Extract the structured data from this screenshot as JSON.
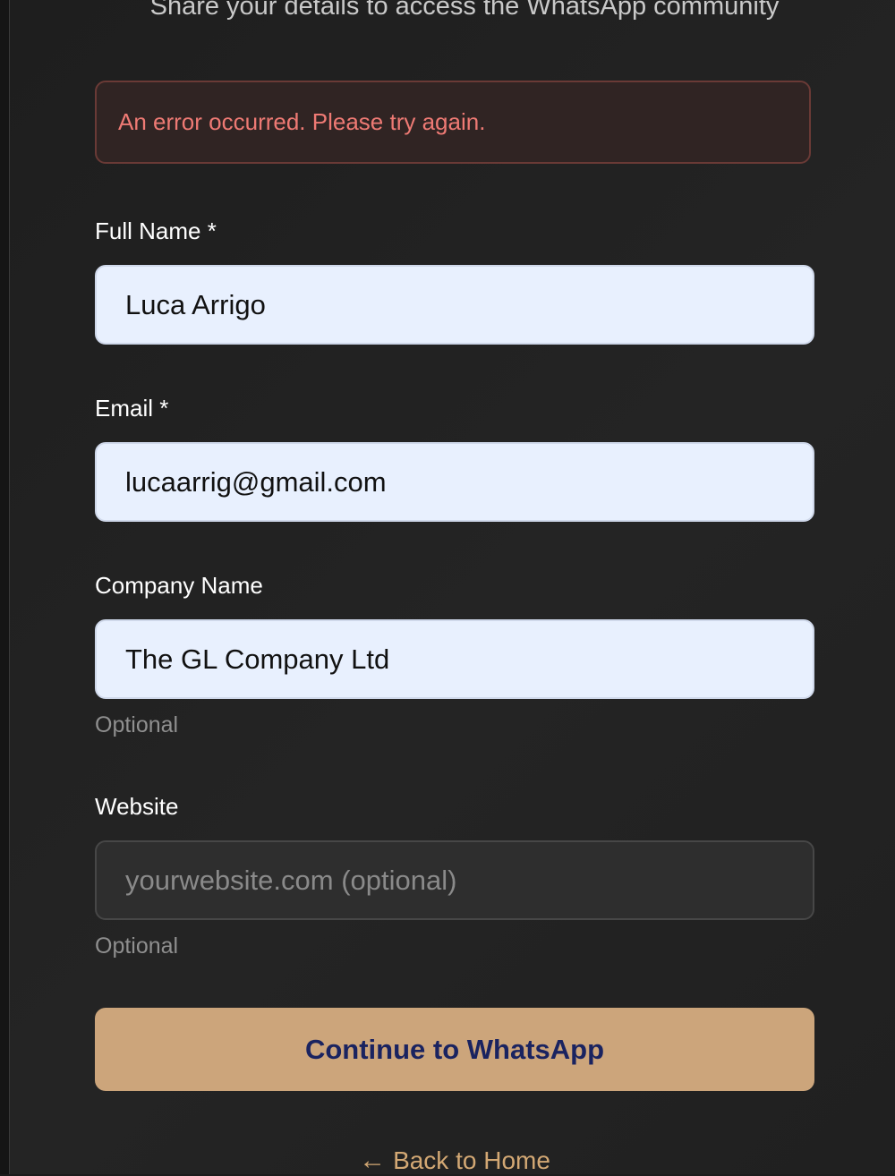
{
  "header": {
    "subtitle": "Share your details to access the WhatsApp community"
  },
  "error": {
    "message": "An error occurred. Please try again."
  },
  "form": {
    "full_name": {
      "label": "Full Name *",
      "value": "Luca Arrigo"
    },
    "email": {
      "label": "Email *",
      "value": "lucaarrig@gmail.com"
    },
    "company": {
      "label": "Company Name",
      "value": "The GL Company Ltd",
      "hint": "Optional"
    },
    "website": {
      "label": "Website",
      "value": "",
      "placeholder": "yourwebsite.com (optional)",
      "hint": "Optional"
    },
    "submit_label": "Continue to WhatsApp"
  },
  "footer": {
    "back_arrow": "←",
    "back_label": "Back to Home"
  },
  "icons": {
    "back_link_icon": "left-arrow-icon"
  },
  "colors": {
    "background": "#1c1c1c",
    "error_text": "#ee7a74",
    "error_background": "#302423",
    "error_border": "#6a3a36",
    "input_filled_background": "#e8f0fe",
    "input_empty_background": "#2e2e2e",
    "button_background": "#cca57b",
    "button_text": "#1a2360",
    "link_color": "#d3a874",
    "hint_text": "#8f8f8f"
  }
}
